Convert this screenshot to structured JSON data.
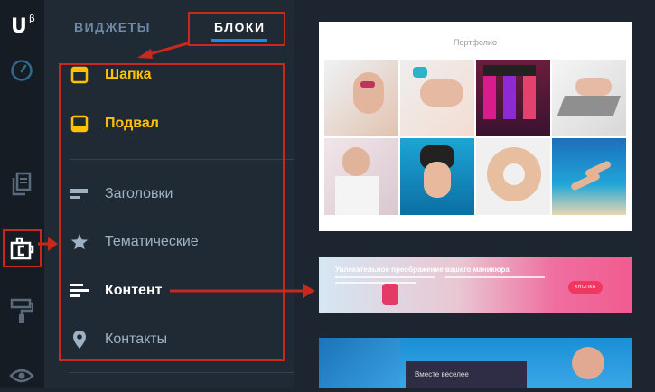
{
  "app": {
    "logo": "U",
    "logo_sup": "β"
  },
  "rail": {
    "items": [
      {
        "icon": "speedometer-icon"
      },
      {
        "icon": "pages-icon"
      },
      {
        "icon": "blocks-icon",
        "active": true
      },
      {
        "icon": "paint-roller-icon"
      },
      {
        "icon": "eye-icon"
      }
    ]
  },
  "panel": {
    "tabs": [
      {
        "label": "ВИДЖЕТЫ",
        "active": false
      },
      {
        "label": "БЛОКИ",
        "active": true
      }
    ],
    "items": [
      {
        "label": "Шапка",
        "icon": "header-block-icon"
      },
      {
        "label": "Подвал",
        "icon": "footer-block-icon"
      },
      {
        "label": "Заголовки",
        "icon": "heading-icon"
      },
      {
        "label": "Тематические",
        "icon": "star-icon"
      },
      {
        "label": "Контент",
        "icon": "content-lines-icon"
      },
      {
        "label": "Контакты",
        "icon": "location-pin-icon"
      }
    ]
  },
  "preview": {
    "portfolio_title": "Портфолио",
    "banner_heading": "Увлекательное преображение вашего маникюра",
    "banner_button": "КНОПКА",
    "bottom_text": "Вместе веселее"
  },
  "colors": {
    "accent_yellow": "#ffc200",
    "tab_underline": "#1e88e5",
    "annotation_red": "#c8281d",
    "panel_bg": "#1f2a35"
  }
}
